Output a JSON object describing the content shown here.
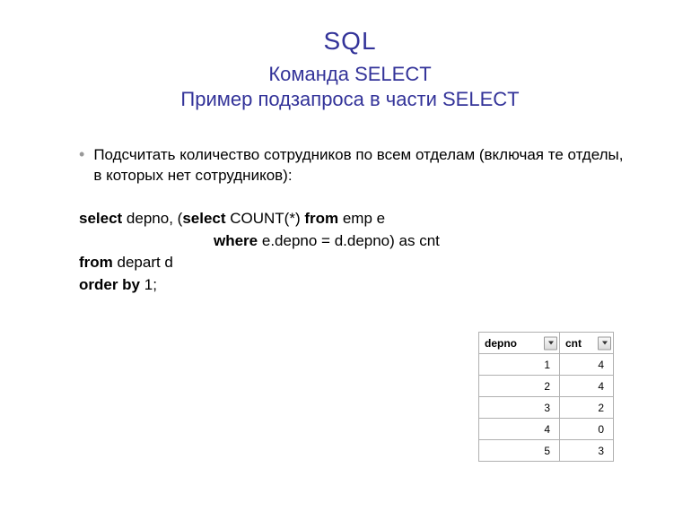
{
  "header": {
    "title": "SQL",
    "subtitle1": "Команда SELECT",
    "subtitle2": "Пример подзапроса в части SELECT"
  },
  "bullet": {
    "text": "Подсчитать количество сотрудников по всем отделам (включая те отделы, в которых нет сотрудников):"
  },
  "code": {
    "kw_select": "select",
    "line1_rest": " depno, (",
    "kw_select2": "select",
    "line1_rest2": " COUNT(*) ",
    "kw_from": "from",
    "line1_rest3": " emp e",
    "kw_where": "where",
    "line2_rest": " e.depno = d.depno) as cnt",
    "kw_from2": "from",
    "line3_rest": " depart d",
    "kw_orderby": "order by",
    "line4_rest": " 1;"
  },
  "table": {
    "headers": {
      "depno": "depno",
      "cnt": "cnt"
    },
    "rows": [
      {
        "depno": "1",
        "cnt": "4"
      },
      {
        "depno": "2",
        "cnt": "4"
      },
      {
        "depno": "3",
        "cnt": "2"
      },
      {
        "depno": "4",
        "cnt": "0"
      },
      {
        "depno": "5",
        "cnt": "3"
      }
    ]
  }
}
